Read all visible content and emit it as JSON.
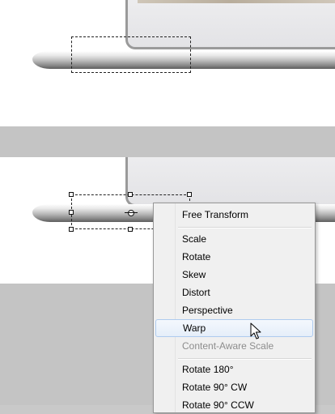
{
  "context_menu": {
    "items": [
      {
        "label": "Free Transform",
        "enabled": true
      },
      {
        "label": "Scale",
        "enabled": true
      },
      {
        "label": "Rotate",
        "enabled": true
      },
      {
        "label": "Skew",
        "enabled": true
      },
      {
        "label": "Distort",
        "enabled": true
      },
      {
        "label": "Perspective",
        "enabled": true
      },
      {
        "label": "Warp",
        "enabled": true,
        "highlighted": true
      },
      {
        "label": "Content-Aware Scale",
        "enabled": false
      },
      {
        "label": "Rotate 180°",
        "enabled": true
      },
      {
        "label": "Rotate 90° CW",
        "enabled": true
      },
      {
        "label": "Rotate 90° CCW",
        "enabled": true
      }
    ]
  },
  "colors": {
    "canvas_background": "#ffffff",
    "workspace_gray": "#c4c4c4",
    "menu_background": "#f0f0f0",
    "menu_highlight_border": "#aecbef",
    "disabled_text": "#8d8d8d"
  },
  "icons": [
    "transform-handle",
    "pivot-point-icon",
    "arrow-cursor-icon"
  ]
}
